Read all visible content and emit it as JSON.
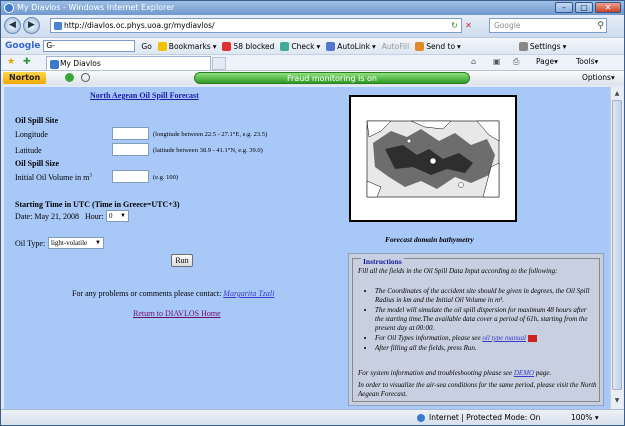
{
  "window": {
    "title": "My Diavlos - Windows Internet Explorer"
  },
  "address": {
    "url": "http://diavlos.oc.phys.uoa.gr/mydiavlos/",
    "search_placeholder": "Google"
  },
  "google_toolbar": {
    "logo": "Google",
    "search_value": "G-",
    "go": "Go",
    "bookmarks": "Bookmarks",
    "blocked": "58 blocked",
    "check": "Check",
    "autolink": "AutoLink",
    "autofill": "AutoFill",
    "sendto": "Send to",
    "settings": "Settings"
  },
  "tabs": [
    {
      "label": "My Diavlos"
    }
  ],
  "command_bar": {
    "page": "Page",
    "tools": "Tools"
  },
  "norton": {
    "brand": "Norton",
    "status": "Fraud monitoring is on",
    "options": "Options"
  },
  "page": {
    "title": "North Aegean Oil Spill Forecast",
    "site_header": "Oil Spill Site",
    "longitude_label": "Longitude",
    "longitude_hint": "(longitude between 22.5 - 27.1°E, e.g. 23.5)",
    "latitude_label": "Latitude",
    "latitude_hint": "(latitude between 38.9 - 41.1°N, e.g. 39.0)",
    "size_header": "Oil Spill Size",
    "volume_label": "Initial Oil Volume in m",
    "volume_sup": "3",
    "volume_hint": "(e.g. 100)",
    "start_header": "Starting Time in UTC (Time in Greece=UTC+3)",
    "date_label": "Date: May 21, 2008",
    "hour_label": "Hour:",
    "hour_value": "0",
    "oil_type_label": "Oil Type:",
    "oil_type_value": "light-volatile",
    "run_label": "Run",
    "contact_text": "For any problems or comments please contact:",
    "contact_name": "Margarita Tzali",
    "return_link": "Return to DIAVLOS Home",
    "map_caption": "Forecast domain bathymetry"
  },
  "instructions": {
    "legend": "Instructions",
    "intro": "Fill all the fields in the Oil Spill Data Input according to the following:",
    "items": [
      "The Coordinates of the accident site should be given in degrees, the Oil Spill Radius in km and the Initial Oil Volume in m³.",
      "The model will simulate the oil spill dispersion for maximum 48 hours after the starting time.The available data cover a period of 61h, starting from the present day at 00:00.",
      "For Oil Types information, please see",
      "After filling all the fields, press Run."
    ],
    "oil_manual_link": "oil type manual",
    "support_text": "For system information and troubleshooting please see",
    "demo_link": "DEMO",
    "support_suffix": "page.",
    "air_sea_text": "In order to visualize the air-sea conditions for the same period, please visit the North Aegean Forecast."
  },
  "status": {
    "zone": "Internet | Protected Mode: On",
    "zoom": "100%"
  }
}
